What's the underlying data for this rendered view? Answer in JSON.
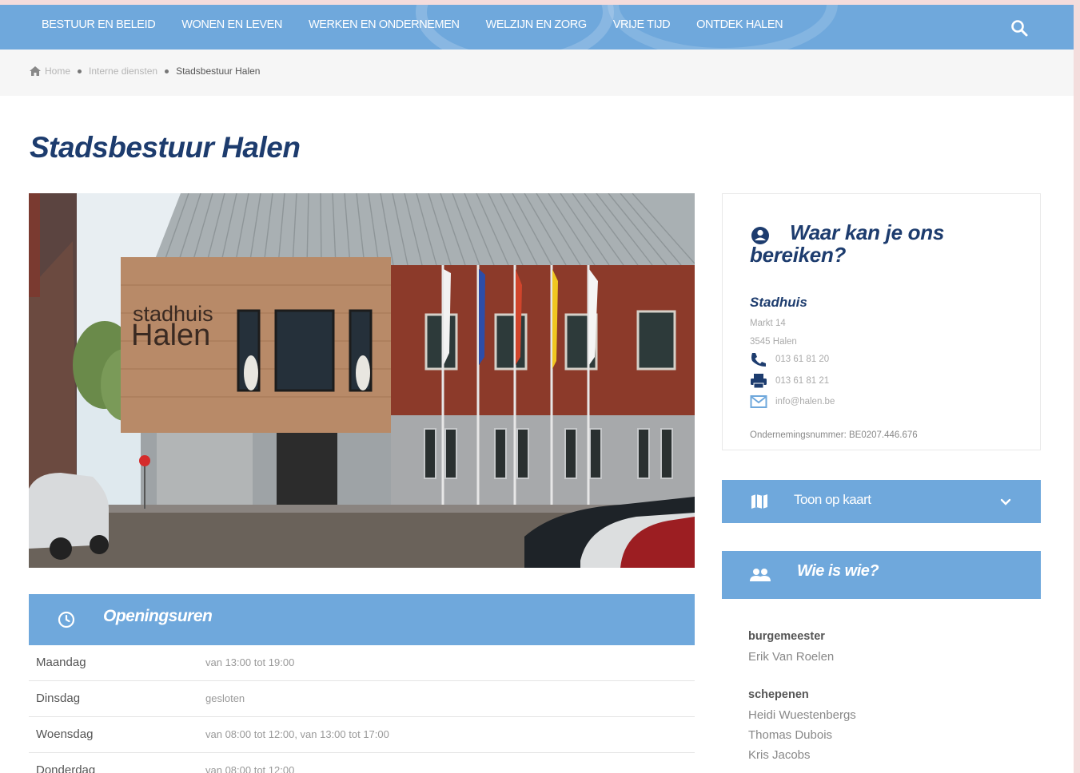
{
  "nav": {
    "items": [
      "BESTUUR EN BELEID",
      "WONEN EN LEVEN",
      "WERKEN EN ONDERNEMEN",
      "WELZIJN EN ZORG",
      "VRIJE TIJD",
      "ONTDEK HALEN"
    ],
    "search_icon": "search-icon"
  },
  "breadcrumb": {
    "items": [
      "Home",
      "Interne diensten",
      "Stadsbestuur Halen"
    ]
  },
  "page": {
    "title": "Stadsbestuur Halen"
  },
  "photo": {
    "sign_line1": "stadhuis",
    "sign_line2": "Halen"
  },
  "hours": {
    "heading": "Openingsuren",
    "rows": [
      {
        "day": "Maandag",
        "time": "van 13:00 tot 19:00"
      },
      {
        "day": "Dinsdag",
        "time": "gesloten"
      },
      {
        "day": "Woensdag",
        "time": "van 08:00 tot 12:00, van 13:00 tot 17:00"
      },
      {
        "day": "Donderdag",
        "time": "van 08:00 tot 12:00"
      }
    ]
  },
  "contact": {
    "heading": "Waar kan je ons bereiken?",
    "org": "Stadhuis",
    "street": "Markt 14",
    "city": "3545 Halen",
    "phone": "013 61 81 20",
    "fax": "013 61 81 21",
    "email": "info@halen.be",
    "vat": "Ondernemingsnummer: BE0207.446.676"
  },
  "map": {
    "label": "Toon op kaart"
  },
  "who": {
    "label": "Wie is wie?",
    "mayor_role": "burgemeester",
    "mayor": "Erik Van Roelen",
    "aldermen_role": "schepenen",
    "aldermen": [
      "Heidi Wuestenbergs",
      "Thomas Dubois",
      "Kris Jacobs"
    ]
  },
  "colors": {
    "accent": "#6fa8dc",
    "title": "#1d3c6e"
  }
}
